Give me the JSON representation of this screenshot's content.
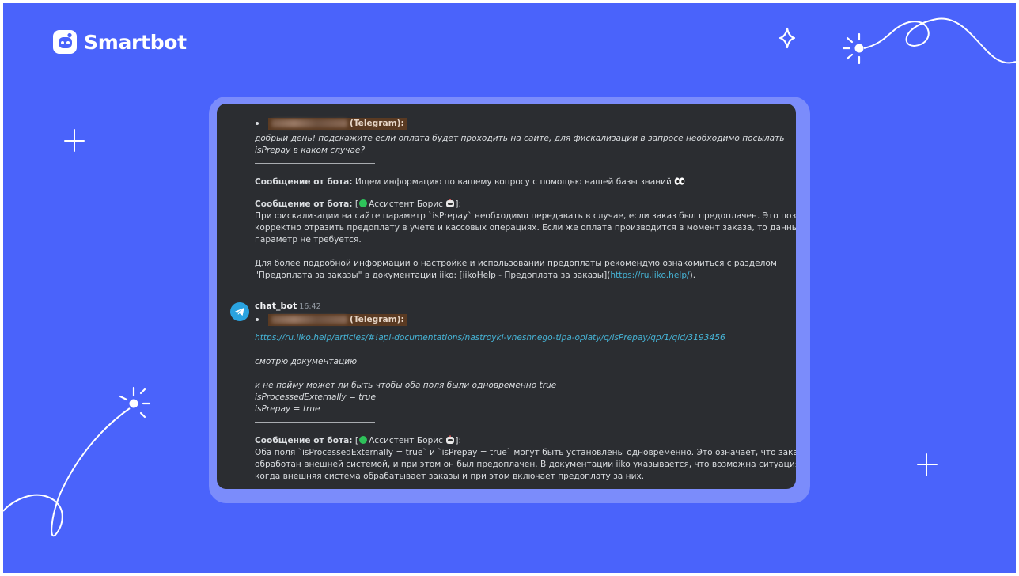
{
  "brand": {
    "name": "Smartbot"
  },
  "colors": {
    "background": "#4a63fb",
    "chat_bg": "#2b2d31",
    "link": "#46b4d6",
    "mention_bg": "#5a3a22"
  },
  "chat": {
    "msg1": {
      "mention_suffix": "(Telegram):",
      "question_lines": [
        "добрый день! подскажите если оплата будет проходить на сайте, для фискализации в запросе необходимо посылать",
        "isPrepay в каком случае?"
      ],
      "bot_label_1": "Сообщение от бота:",
      "bot_text_1": " Ищем информацию по вашему вопросу с помощью нашей базы знаний",
      "bot_label_2": "Сообщение от бота:",
      "assistant_open": " [",
      "assistant_name": "Ассистент Борис",
      "assistant_close": "]:",
      "answer_lines": [
        "При фискализации на сайте параметр `isPrepay` необходимо передавать в случае, если заказ был предоплачен. Это позволяет",
        "корректно отразить предоплату в учете и кассовых операциях. Если же оплата производится в момент заказа, то данный",
        "параметр не требуется."
      ],
      "more_line_1": "Для более подробной информации о настройке и использовании предоплаты рекомендую ознакомиться с разделом",
      "more_line_2_prefix": "\"Предоплата за заказы\" в документации iiko: [iikoHelp - Предоплата за заказы](",
      "more_link": "https://ru.iiko.help/",
      "more_line_2_suffix": ")."
    },
    "msg2": {
      "author": "chat_bot",
      "time": "16:42",
      "mention_suffix": "(Telegram):",
      "link": "https://ru.iiko.help/articles/#!api-documentations/nastroyki-vneshnego-tipa-oplaty/q/isPrepay/qp/1/qid/3193456",
      "line_docs": "смотрю документацию",
      "q_lines": [
        "и не пойму может ли быть чтобы оба поля были одновременно true",
        "isProcessedExternally = true",
        "isPrepay = true"
      ],
      "bot_label": "Сообщение от бота:",
      "assistant_open": " [",
      "assistant_name": "Ассистент Борис",
      "assistant_close": "]:",
      "answer_lines": [
        "Оба поля `isProcessedExternally = true` и `isPrepay = true` могут быть установлены одновременно. Это означает, что заказ был",
        "обработан внешней системой, и при этом он был предоплачен. В документации iiko указывается, что возможна ситуация,",
        "когда внешняя система обрабатывает заказы и при этом включает предоплату за них."
      ]
    }
  }
}
